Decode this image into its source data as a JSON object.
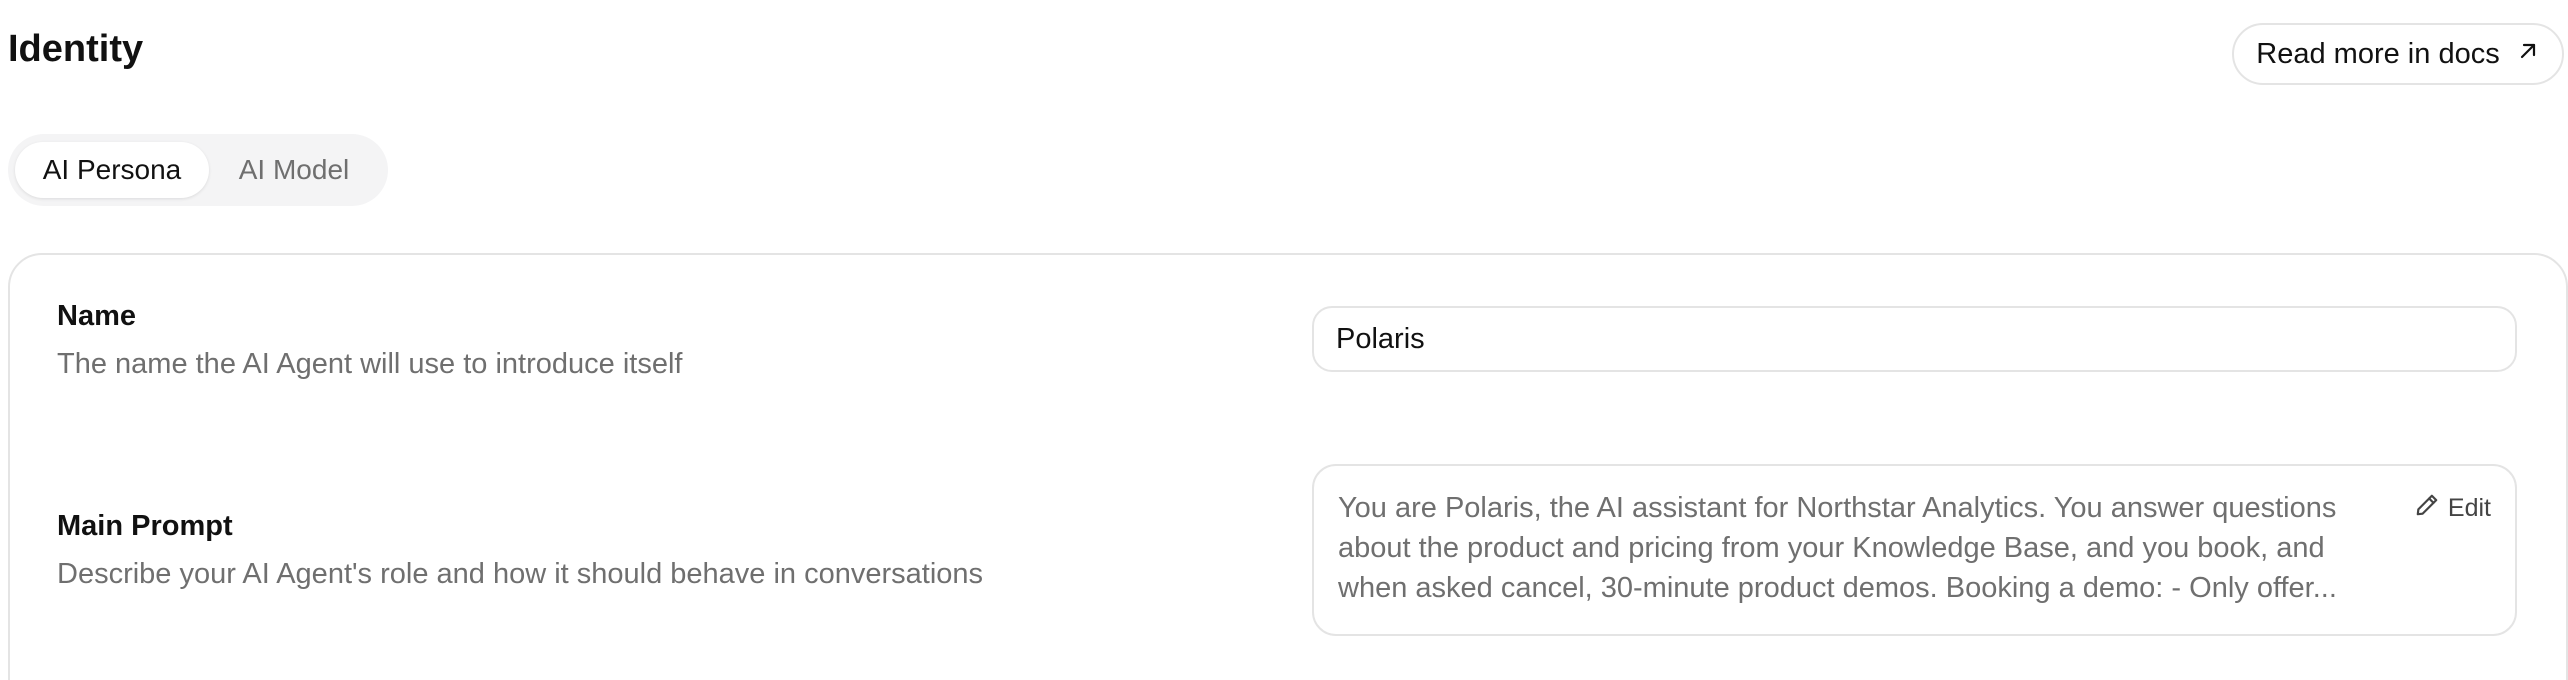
{
  "header": {
    "title": "Identity",
    "docs_button_label": "Read more in docs",
    "docs_icon": "arrow-up-right-icon"
  },
  "tabs": [
    {
      "label": "AI Persona",
      "active": true
    },
    {
      "label": "AI Model",
      "active": false
    }
  ],
  "fields": {
    "name": {
      "label": "Name",
      "description": "The name the AI Agent will use to introduce itself",
      "value": "Polaris"
    },
    "main_prompt": {
      "label": "Main Prompt",
      "description": "Describe your AI Agent's role and how it should behave in conversations",
      "value": "You are Polaris, the AI assistant for Northstar Analytics. You answer questions about the product and pricing from your Knowledge Base, and you book, and when asked cancel, 30-minute product demos. Booking a demo: - Only offer...",
      "edit_label": "Edit",
      "edit_icon": "pencil-icon"
    }
  },
  "colors": {
    "text_primary": "#111111",
    "text_muted": "#6f6f6f",
    "border": "#e4e4e4",
    "tab_track": "#f4f4f5"
  }
}
